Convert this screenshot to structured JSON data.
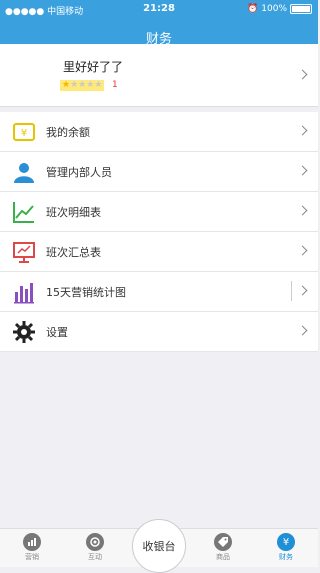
{
  "status": {
    "carrier": "●●●●● 中国移动",
    "time": "21:28",
    "battery": "100%"
  },
  "header": {
    "title": "财务"
  },
  "profile": {
    "name": "里好好了了",
    "stars_filled": 1,
    "stars_total": 5,
    "level": "1"
  },
  "menu": [
    {
      "label": "我的余额",
      "icon": "yen-icon"
    },
    {
      "label": "管理内部人员",
      "icon": "person-icon"
    },
    {
      "label": "班次明细表",
      "icon": "line-chart-icon"
    },
    {
      "label": "班次汇总表",
      "icon": "presentation-icon"
    },
    {
      "label": "15天营销统计图",
      "icon": "bar-chart-icon"
    },
    {
      "label": "设置",
      "icon": "gear-icon"
    }
  ],
  "tabs": [
    {
      "label": "营销"
    },
    {
      "label": "互动"
    },
    {
      "label": "收银台"
    },
    {
      "label": "商品"
    },
    {
      "label": "财务"
    }
  ],
  "colors": {
    "accent": "#3aa0de"
  }
}
